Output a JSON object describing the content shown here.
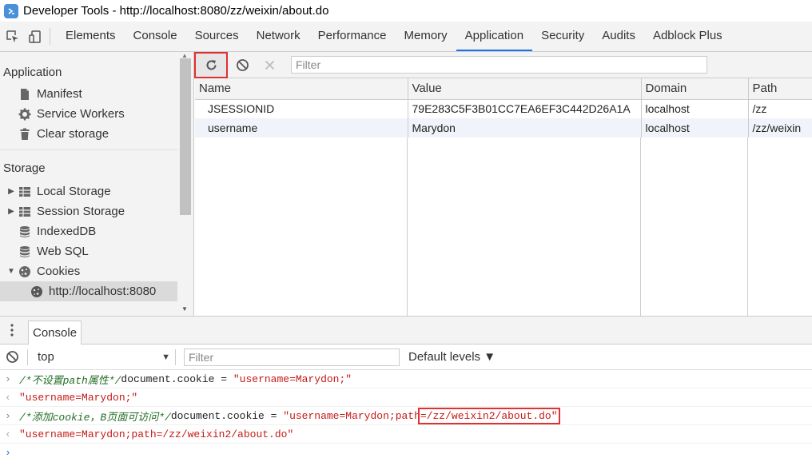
{
  "window": {
    "title": "Developer Tools - http://localhost:8080/zz/weixin/about.do",
    "icon": "devtools-app-icon"
  },
  "tabs": [
    {
      "label": "Elements"
    },
    {
      "label": "Console"
    },
    {
      "label": "Sources"
    },
    {
      "label": "Network"
    },
    {
      "label": "Performance"
    },
    {
      "label": "Memory"
    },
    {
      "label": "Application",
      "active": true
    },
    {
      "label": "Security"
    },
    {
      "label": "Audits"
    },
    {
      "label": "Adblock Plus"
    }
  ],
  "sidebar": {
    "application_title": "Application",
    "application_items": [
      {
        "label": "Manifest",
        "icon": "document-icon"
      },
      {
        "label": "Service Workers",
        "icon": "gear-icon"
      },
      {
        "label": "Clear storage",
        "icon": "trash-icon"
      }
    ],
    "storage_title": "Storage",
    "storage_items": [
      {
        "label": "Local Storage",
        "icon": "grid-icon"
      },
      {
        "label": "Session Storage",
        "icon": "grid-icon"
      },
      {
        "label": "IndexedDB",
        "icon": "database-icon"
      },
      {
        "label": "Web SQL",
        "icon": "database-icon"
      },
      {
        "label": "Cookies",
        "icon": "cookie-icon"
      },
      {
        "label": "http://localhost:8080",
        "icon": "cookie-icon"
      }
    ]
  },
  "cookies_panel": {
    "filter_placeholder": "Filter",
    "columns": [
      "Name",
      "Value",
      "Domain",
      "Path"
    ],
    "rows": [
      {
        "name": "JSESSIONID",
        "value": "79E283C5F3B01CC7EA6EF3C442D26A1A",
        "domain": "localhost",
        "path": "/zz"
      },
      {
        "name": "username",
        "value": "Marydon",
        "domain": "localhost",
        "path": "/zz/weixin"
      }
    ]
  },
  "drawer": {
    "tab_label": "Console"
  },
  "console": {
    "context": "top",
    "filter_placeholder": "Filter",
    "levels_label": "Default levels ▼",
    "lines": [
      {
        "kind": "input",
        "comment": "/*不设置path属性*/",
        "code": "document.cookie = ",
        "str": "\"username=Marydon;\""
      },
      {
        "kind": "output",
        "result": "\"username=Marydon;\""
      },
      {
        "kind": "input",
        "comment": "/*添加cookie，B页面可访问*/",
        "code": "document.cookie = ",
        "str_prefix": "\"username=Marydon;path",
        "str_highlight": "=/zz/weixin2/about.do\""
      },
      {
        "kind": "output",
        "result": "\"username=Marydon;path=/zz/weixin2/about.do\""
      }
    ]
  },
  "colors": {
    "accent": "#1a73e8",
    "highlight": "#e03131"
  }
}
